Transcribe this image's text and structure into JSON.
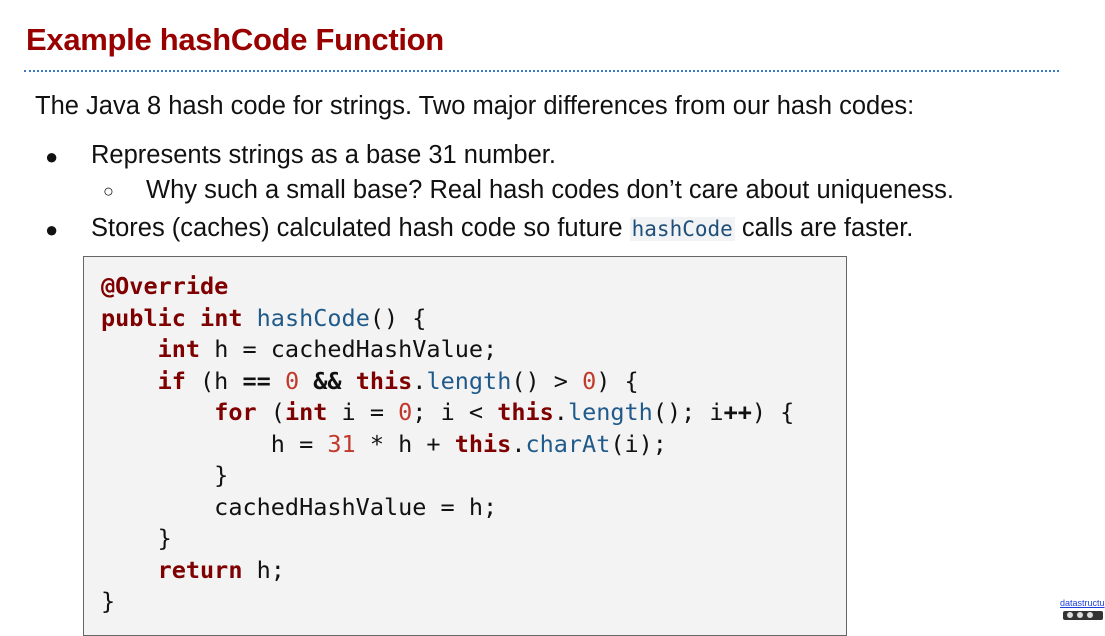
{
  "slide": {
    "title": "Example hashCode Function",
    "intro": "The Java 8 hash code for strings. Two major differences from our hash codes:",
    "bullets": [
      {
        "marker": "●",
        "text": "Represents strings as a base 31 number.",
        "sub": {
          "marker": "○",
          "text": "Why such a small base? Real hash codes don’t care about uniqueness."
        }
      },
      {
        "marker": "●",
        "text_before": "Stores (caches) calculated hash code so future ",
        "code": "hashCode",
        "text_after": " calls are faster."
      }
    ],
    "code_lines": [
      "@Override",
      "public int hashCode() {",
      "    int h = cachedHashValue;",
      "    if (h == 0 && this.length() > 0) {",
      "        for (int i = 0; i < this.length(); i++) {",
      "            h = 31 * h + this.charAt(i);",
      "        }",
      "        cachedHashValue = h;",
      "    }",
      "    return h;",
      "}"
    ],
    "footer_link": "datastructu"
  },
  "colors": {
    "title": "#990000",
    "rule": "#3b78c5",
    "keyword": "#7f0000",
    "method": "#1f5a8a",
    "number": "#c0392b",
    "code_bg": "#f3f3f3"
  }
}
